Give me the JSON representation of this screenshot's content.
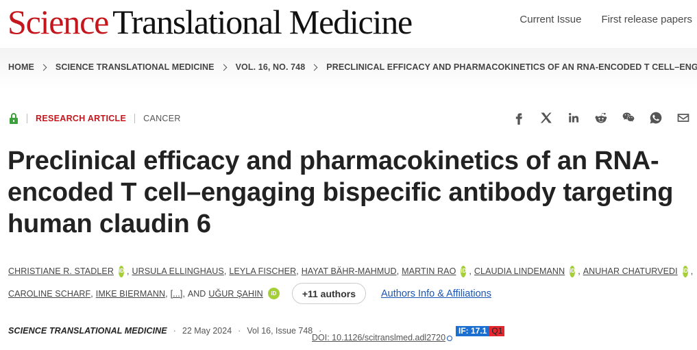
{
  "header": {
    "logo_science": "Science",
    "logo_rest": "Translational Medicine",
    "nav": [
      "Current Issue",
      "First release papers"
    ],
    "brand_color": "#c4161c"
  },
  "breadcrumb": [
    "HOME",
    "SCIENCE TRANSLATIONAL MEDICINE",
    "VOL. 16, NO. 748",
    "PRECLINICAL EFFICACY AND PHARMACOKINETICS OF AN RNA-ENCODED T CELL–ENGAGIN..."
  ],
  "article": {
    "access_icon": "lock-open-icon",
    "type": "RESEARCH ARTICLE",
    "subject": "CANCER",
    "title": "Preclinical efficacy and pharmacokinetics of an RNA-encoded T cell–engaging bispecific antibody targeting human claudin 6"
  },
  "share_icons": [
    "facebook-icon",
    "x-icon",
    "linkedin-icon",
    "reddit-icon",
    "wechat-icon",
    "whatsapp-icon",
    "email-icon"
  ],
  "authors": {
    "line1": [
      {
        "name": "Christiane R. Stadler",
        "orcid": true
      },
      {
        "name": "Ursula Ellinghaus",
        "orcid": false
      },
      {
        "name": "Leyla Fischer",
        "orcid": false
      },
      {
        "name": "Hayat Bähr-Mahmud",
        "orcid": false
      },
      {
        "name": "Martin Rao",
        "orcid": true
      },
      {
        "name": "Claudia Lindemann",
        "orcid": true
      },
      {
        "name": "Anuhar Chaturvedi",
        "orcid": true
      }
    ],
    "line2": [
      {
        "name": "Caroline Scharf"
      },
      {
        "name": "Imke Biermann"
      }
    ],
    "ellipsis": "[...]",
    "and": "AND",
    "last_author": "Uğur Şahin",
    "orcid_label": "iD",
    "more_button": "+11 authors",
    "affiliations_link": "Authors Info & Affiliations"
  },
  "citation": {
    "journal": "Science Translational Medicine",
    "date": "22 May 2024",
    "volume_issue": "Vol 16, Issue 748",
    "doi": "DOI: 10.1126/scitranslmed.adl2720",
    "impact_factor": "IF: 17.1",
    "quartile": "Q1"
  }
}
